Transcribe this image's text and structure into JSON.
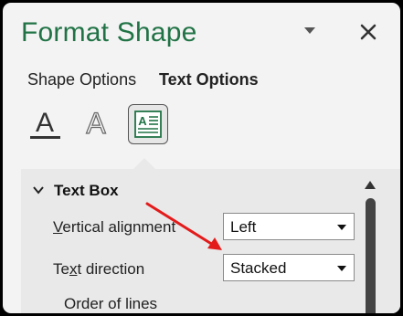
{
  "header": {
    "title": "Format Shape",
    "dropdown_icon": "chevron-down-icon",
    "close_icon": "close-icon"
  },
  "tabs": [
    {
      "label": "Shape Options",
      "active": false
    },
    {
      "label": "Text Options",
      "active": true
    }
  ],
  "icon_buttons": [
    {
      "name": "text-fill-outline-icon",
      "letter": "A",
      "selected": false
    },
    {
      "name": "text-effects-icon",
      "letter": "A",
      "selected": false
    },
    {
      "name": "text-box-icon",
      "letter": "A",
      "selected": true
    }
  ],
  "section": {
    "title": "Text Box",
    "expanded": true
  },
  "fields": {
    "vertical_alignment": {
      "label_hotkey": "V",
      "label_rest": "ertical alignment",
      "value": "Left"
    },
    "text_direction": {
      "label_pre": "Te",
      "label_hotkey": "x",
      "label_post": "t direction",
      "value": "Stacked"
    },
    "order_of_lines": {
      "label": "Order of lines"
    }
  },
  "colors": {
    "title": "#217346",
    "annotation_arrow": "#e31b1b"
  }
}
